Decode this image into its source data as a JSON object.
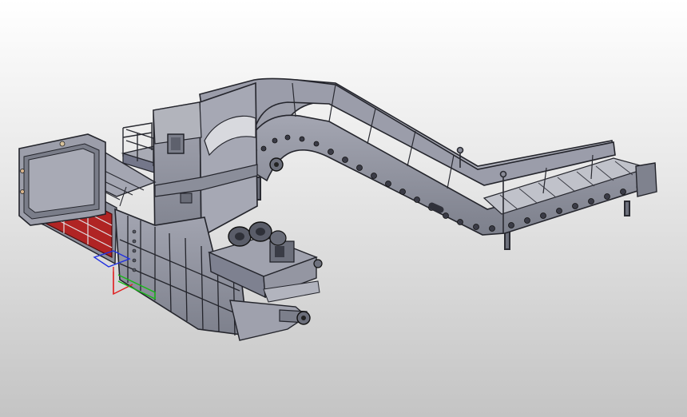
{
  "viewport": {
    "background_top": "#ffffff",
    "background_bottom": "#c4c4c4"
  },
  "model": {
    "frame_color": "#8e909c",
    "frame_dark": "#5b5d68",
    "edge_color": "#24252c",
    "chamber_color": "#b02424",
    "icons": [
      "baler-machine",
      "chain-conveyor",
      "feed-hopper",
      "hydraulic-power-unit",
      "press-chamber",
      "axis-triad"
    ]
  },
  "axis_triad": {
    "colors": {
      "x": "#e02020",
      "y": "#18b818",
      "z": "#2030e0"
    }
  }
}
